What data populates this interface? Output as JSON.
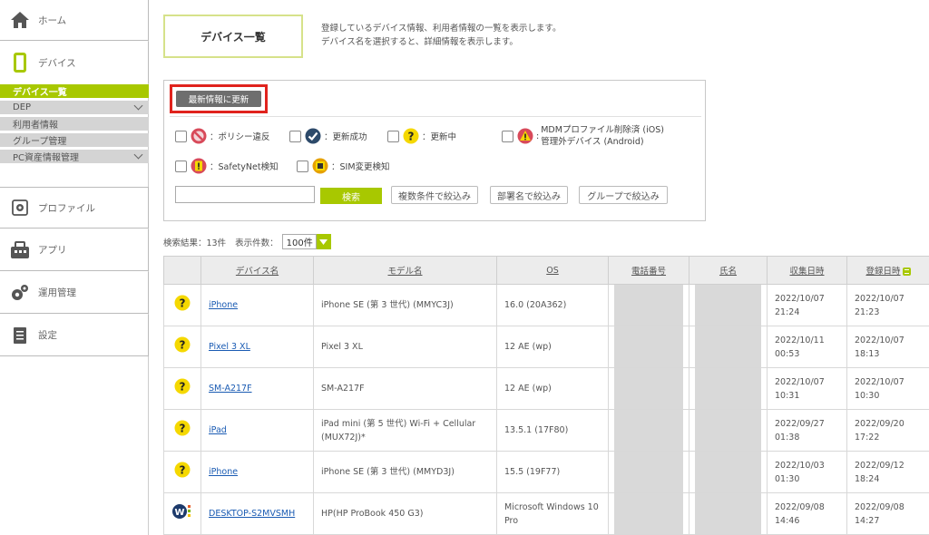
{
  "sidebar": {
    "home": "ホーム",
    "devices": "デバイス",
    "sub_items": [
      {
        "label": "デバイス一覧",
        "selected": true,
        "chevron": false
      },
      {
        "label": "DEP",
        "selected": false,
        "chevron": true
      },
      {
        "label": "利用者情報",
        "selected": false,
        "chevron": false
      },
      {
        "label": "グループ管理",
        "selected": false,
        "chevron": false
      },
      {
        "label": "PC資産情報管理",
        "selected": false,
        "chevron": true
      }
    ],
    "profile": "プロファイル",
    "apps": "アプリ",
    "operations": "運用管理",
    "settings": "設定"
  },
  "header": {
    "title": "デバイス一覧",
    "desc_line1": "登録しているデバイス情報、利用者情報の一覧を表示します。",
    "desc_line2": "デバイス名を選択すると、詳細情報を表示します。"
  },
  "filters": {
    "refresh_button": "最新情報に更新",
    "policy_violation": "：ポリシー違反",
    "update_success": "：更新成功",
    "updating": "：更新中",
    "mdm_removed_line1": "MDMプロファイル削除済 (iOS)",
    "mdm_removed_line2": "管理外デバイス (Android)",
    "safetynet": "：SafetyNet検知",
    "sim_change": "：SIM変更検知",
    "search_placeholder": "",
    "search_button": "検索",
    "multi_filter": "複数条件で絞込み",
    "dept_filter": "部署名で絞込み",
    "group_filter": "グループで絞込み"
  },
  "results": {
    "count_text": "検索結果：13件",
    "per_page_label": "表示件数：",
    "per_page_value": "100件"
  },
  "table": {
    "headers": {
      "device_name": "デバイス名",
      "model_name": "モデル名",
      "os": "OS",
      "phone": "電話番号",
      "name": "氏名",
      "collected": "収集日時",
      "registered": "登録日時"
    },
    "rows": [
      {
        "icon": "updating",
        "device": "iPhone",
        "model": "iPhone SE (第 3 世代) (MMYC3J)",
        "os": "16.0 (20A362)",
        "collected": "2022/10/07 21:24",
        "registered": "2022/10/07 21:23"
      },
      {
        "icon": "updating",
        "device": "Pixel 3 XL",
        "model": "Pixel 3 XL",
        "os": "12 AE (wp)",
        "collected": "2022/10/11 00:53",
        "registered": "2022/10/07 18:13"
      },
      {
        "icon": "updating",
        "device": "SM-A217F",
        "model": "SM-A217F",
        "os": "12 AE (wp)",
        "collected": "2022/10/07 10:31",
        "registered": "2022/10/07 10:30"
      },
      {
        "icon": "updating",
        "device": "iPad",
        "model": "iPad mini (第 5 世代) Wi-Fi + Cellular (MUX72J)*",
        "os": "13.5.1 (17F80)",
        "collected": "2022/09/27 01:38",
        "registered": "2022/09/20 17:22"
      },
      {
        "icon": "updating",
        "device": "iPhone",
        "model": "iPhone SE (第 3 世代) (MMYD3J)",
        "os": "15.5 (19F77)",
        "collected": "2022/10/03 01:30",
        "registered": "2022/09/12 18:24"
      },
      {
        "icon": "windows-agent",
        "device": "DESKTOP-S2MVSMH",
        "model": "HP(HP ProBook 450 G3)",
        "os": "Microsoft Windows 10 Pro",
        "collected": "2022/09/08 14:46",
        "registered": "2022/09/08 14:27"
      }
    ]
  },
  "colors": {
    "accent": "#a8c800",
    "highlight_border": "#e0231d",
    "link": "#1a5bb3"
  }
}
